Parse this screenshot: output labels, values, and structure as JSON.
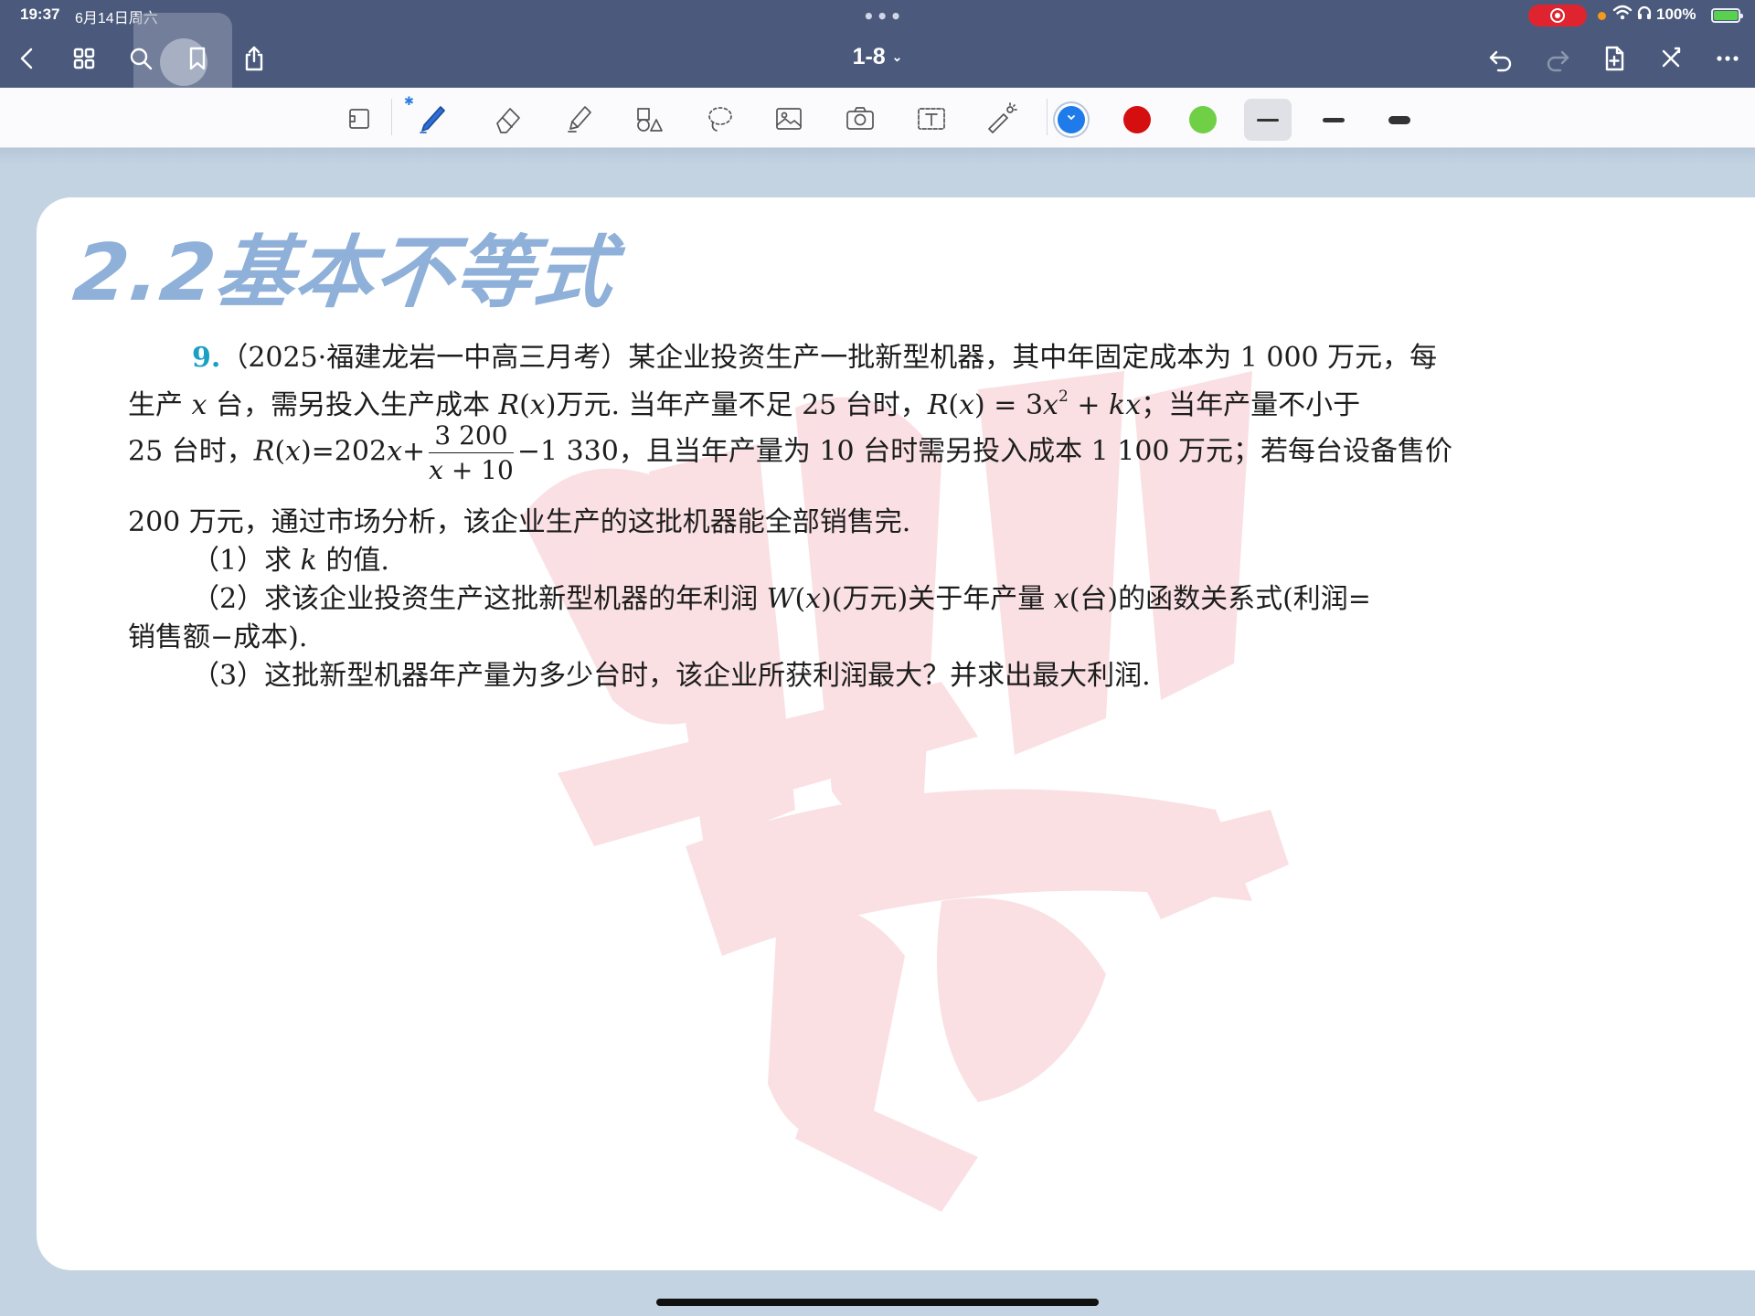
{
  "status_bar": {
    "time": "19:37",
    "date": "6月14日周六",
    "battery": "100%",
    "record_color": "#e0242f",
    "icons": [
      "screen-record-icon",
      "orange-dot-icon",
      "wifi-icon",
      "headphones-icon",
      "battery-charging-icon"
    ]
  },
  "nav": {
    "title": "1-8",
    "left_icons": [
      "back-chevron-icon",
      "grid-icon",
      "search-icon",
      "bookmark-icon",
      "share-icon"
    ],
    "right_icons": [
      "undo-icon",
      "redo-icon",
      "add-page-icon",
      "close-icon",
      "more-icon"
    ],
    "background": "#4b5a7c"
  },
  "toolbar": {
    "tools": [
      "page-tool-icon",
      "pen-icon",
      "eraser-icon",
      "highlighter-icon",
      "shapes-icon",
      "lasso-icon",
      "image-icon",
      "camera-icon",
      "text-box-icon",
      "laser-pointer-icon"
    ],
    "colors": [
      "#1f7bea",
      "#d50f0f",
      "#6fd046"
    ],
    "selected_color": "#1f7bea",
    "stroke_widths": [
      "thin",
      "medium",
      "thick"
    ],
    "selected_stroke": "thin"
  },
  "document": {
    "heading": "2.2基本不等式",
    "heading_color": "#8fb0d8",
    "problem": {
      "number": "9.",
      "l1": "（2025·福建龙岩一中高三月考）某企业投资生产一批新型机器，其中年固定成本为 1 000 万元，每",
      "l2a": "生产 ",
      "l2x": "x",
      "l2b": " 台，需另投入生产成本 ",
      "l2R": "R",
      "l2c": "(",
      "l2x2": "x",
      "l2d": ")万元. 当年产量不足 25 台时，",
      "l2R2": "R",
      "l2e": "(",
      "l2x3": "x",
      "l2f": ") = 3",
      "l2x4": "x",
      "l2sup": "2",
      "l2g": " + ",
      "l2k": "kx",
      "l2h": "；当年产量不小于",
      "l3a": "25 台时，",
      "l3R": "R",
      "l3b": "(",
      "l3x": "x",
      "l3c": ")=202",
      "l3x2": "x",
      "l3d": "+",
      "frac_num": "3 200",
      "frac_den_x": "x",
      "frac_den": " + 10",
      "l3e": "−1 330，且当年产量为 10 台时需另投入成本 1 100 万元；若每台设备售价",
      "l4": "200 万元，通过市场分析，该企业生产的这批机器能全部销售完.",
      "q1a": "（1）求 ",
      "q1k": "k",
      "q1b": " 的值.",
      "q2a": "（2）求该企业投资生产这批新型机器的年利润 ",
      "q2W": "W",
      "q2b": "(",
      "q2x": "x",
      "q2c": ")(万元)关于年产量 ",
      "q2x2": "x",
      "q2d": "(台)的函数关系式(利润=",
      "q2e": "销售额−成本).",
      "q3": "（3）这批新型机器年产量为多少台时，该企业所获利润最大？并求出最大利润."
    }
  }
}
